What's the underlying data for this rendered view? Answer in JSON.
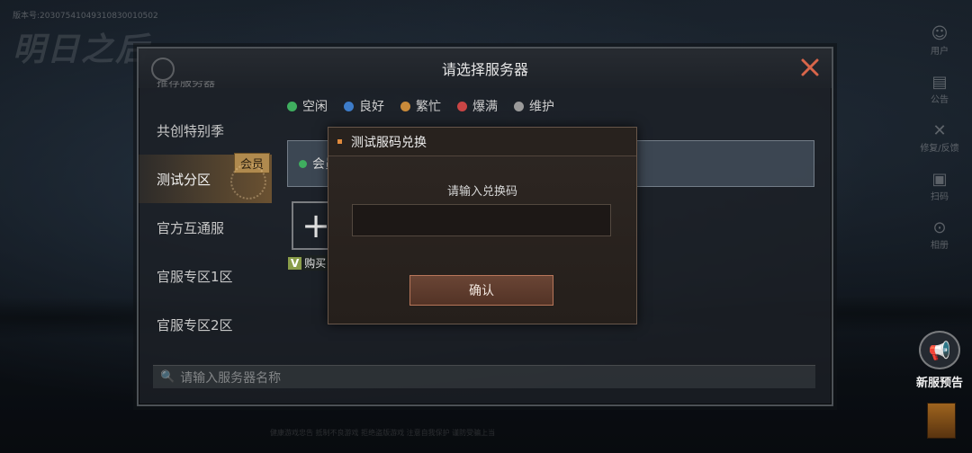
{
  "background": {
    "version_text": "版本号:20307541049310830010502",
    "logo_text": "明日之后",
    "footer_text": "健康游戏忠告 抵制不良游戏 拒绝盗版游戏 注意自我保护 谨防受骗上当"
  },
  "right_menu": {
    "items": [
      {
        "label": "用户",
        "icon": "user-icon"
      },
      {
        "label": "公告",
        "icon": "notice-icon"
      },
      {
        "label": "修复/反馈",
        "icon": "repair-icon"
      },
      {
        "label": "扫码",
        "icon": "scan-icon"
      },
      {
        "label": "相册",
        "icon": "album-icon"
      }
    ],
    "news_label": "新服预告"
  },
  "server_dialog": {
    "title": "请选择服务器",
    "sidebar": {
      "clipped_label": "推荐服务器",
      "items": [
        {
          "label": "共创特别季",
          "active": false
        },
        {
          "label": "测试分区",
          "active": true,
          "badge": "会员"
        },
        {
          "label": "官方互通服",
          "active": false
        },
        {
          "label": "官服专区1区",
          "active": false
        },
        {
          "label": "官服专区2区",
          "active": false
        }
      ]
    },
    "legend": [
      {
        "label": "空闲",
        "color": "#3fae5f"
      },
      {
        "label": "良好",
        "color": "#3d7cc9"
      },
      {
        "label": "繁忙",
        "color": "#c98a3a"
      },
      {
        "label": "爆满",
        "color": "#c94545"
      },
      {
        "label": "维护",
        "color": "#9a9a9a"
      }
    ],
    "server_card": {
      "label": "会员",
      "status_color": "#3fae5f"
    },
    "add_symbol": "+",
    "buy_tag": {
      "prefix": "V",
      "label": "购买"
    },
    "search_placeholder": "请输入服务器名称"
  },
  "redeem_modal": {
    "title": "测试服码兑换",
    "prompt": "请输入兑换码",
    "input_value": "",
    "confirm_label": "确认"
  }
}
